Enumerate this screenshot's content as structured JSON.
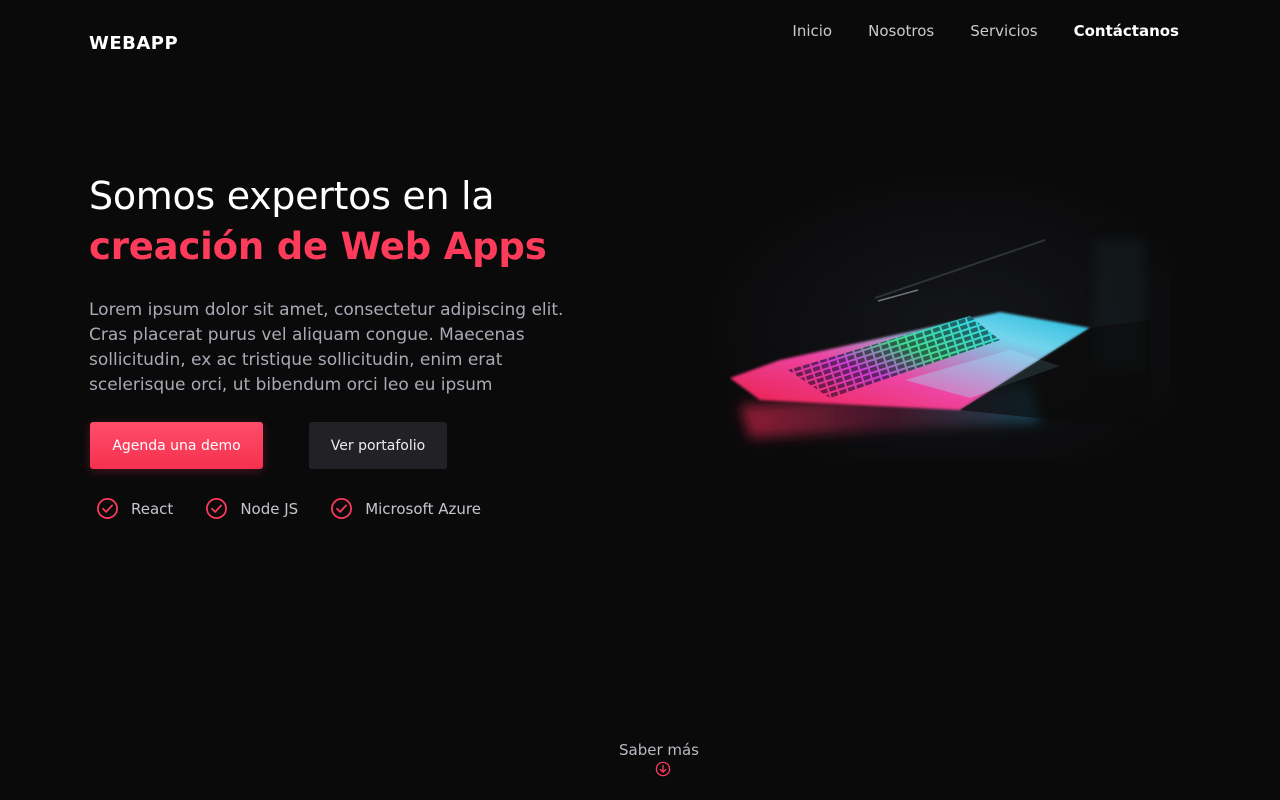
{
  "header": {
    "logo": "WEBAPP",
    "nav": [
      {
        "label": "Inicio"
      },
      {
        "label": "Nosotros"
      },
      {
        "label": "Servicios"
      },
      {
        "label": "Contáctanos"
      }
    ]
  },
  "hero": {
    "title_line1": "Somos expertos en la",
    "title_line2": "creación de Web Apps",
    "description": "Lorem ipsum dolor sit amet, consectetur adipiscing elit. Cras placerat purus vel aliquam congue. Maecenas sollicitudin, ex ac tristique sollicitudin, enim erat scelerisque orci, ut bibendum orci leo eu ipsum",
    "primary_button": "Agenda una demo",
    "secondary_button": "Ver portafolio",
    "technologies": [
      {
        "label": "React"
      },
      {
        "label": "Node JS"
      },
      {
        "label": "Microsoft Azure"
      }
    ]
  },
  "footer_cta": {
    "label": "Saber más"
  },
  "colors": {
    "background": "#0a0a0b",
    "accent": "#ff3b5c",
    "text_muted": "#a9abb4"
  },
  "icons": {
    "tech_check": "check-circle-icon",
    "scroll_down": "arrow-down-circle-icon"
  }
}
